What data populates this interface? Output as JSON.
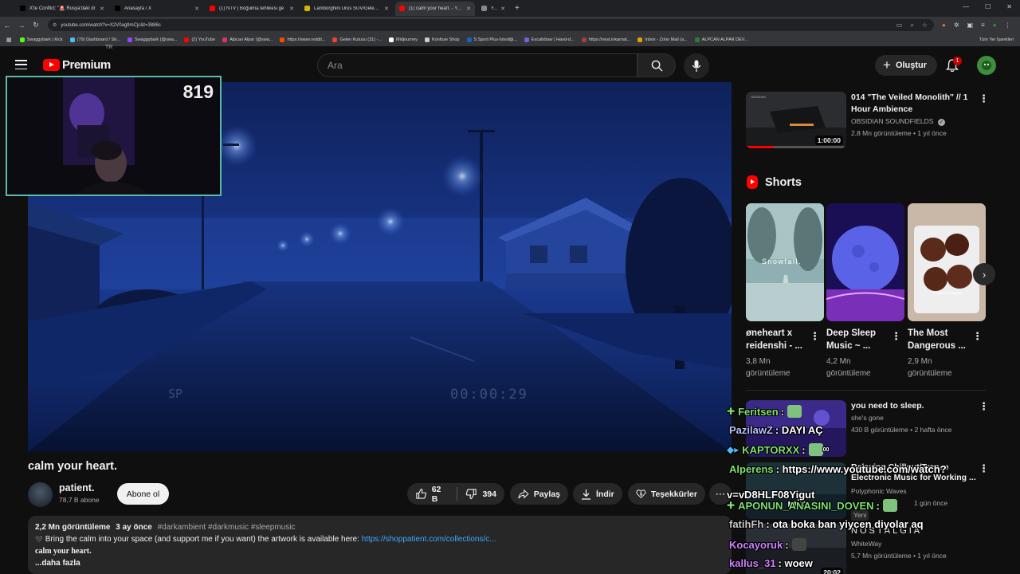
{
  "browser": {
    "tabs": [
      {
        "label": "X'te Conflict: \"🚨 Rusya'daki dr",
        "color": "#000000"
      },
      {
        "label": "Anasayfa / X",
        "color": "#000000"
      },
      {
        "label": "(1) NTV | Boğulma tehlikesi ge",
        "color": "#ff0000"
      },
      {
        "label": "Lamborghini Urus SUV/Gelenek",
        "color": "#d6b400"
      },
      {
        "label": "(1) calm your heart. - YouT",
        "color": "#ff0000",
        "active": true
      },
      {
        "label": "Yükle",
        "color": "#888888"
      }
    ],
    "new_tab": "+",
    "url": "youtube.com/watch?v=X2V0ag9mCjc&t=3886s",
    "bookmarks": [
      {
        "label": "Swaggybark | Kick",
        "color": "#53fc18"
      },
      {
        "label": "(79) Dashboard / Str...",
        "color": "#4fb9f9"
      },
      {
        "label": "Swaggybark (@swa...",
        "color": "#9146ff"
      },
      {
        "label": "(2) YouTube",
        "color": "#ff0000"
      },
      {
        "label": "Alpcan Alpar (@swa...",
        "color": "#e1306c"
      },
      {
        "label": "https://www.reddit...",
        "color": "#ff4500"
      },
      {
        "label": "Gelen Kutusu (31) -...",
        "color": "#ea4335"
      },
      {
        "label": "Midjourney",
        "color": "#ffffff"
      },
      {
        "label": "Konfuse Shop",
        "color": "#cccccc"
      },
      {
        "label": "S Sport Plus-İstediği...",
        "color": "#1565c0"
      },
      {
        "label": "Excalidraw | Hand-d...",
        "color": "#6965db"
      },
      {
        "label": "https://nest.inkarnat...",
        "color": "#a04040"
      },
      {
        "label": "Inbox - Zoho Mail (a...",
        "color": "#e0a000"
      },
      {
        "label": "ALPCAN ALPAR DEV...",
        "color": "#2e7d32"
      }
    ],
    "bookmarks_right": "Tüm Yer İşaretleri"
  },
  "header": {
    "logo_text": "Premium",
    "logo_sup": "TR",
    "search_placeholder": "Ara",
    "create_label": "Oluştur",
    "notif_count": "1"
  },
  "player": {
    "webcam_count": "819",
    "overlay_time": "00:00:29",
    "overlay_sp": "SP"
  },
  "video": {
    "title": "calm your heart.",
    "channel": "patient.",
    "subs": "78,7 B abone",
    "subscribe": "Abone ol",
    "likes": "62 B",
    "dislikes": "394",
    "share": "Paylaş",
    "download": "İndir",
    "thanks": "Teşekkürler",
    "more": "⋯"
  },
  "description": {
    "views": "2,2 Mn görüntüleme",
    "date": "3 ay önce",
    "tags": "#darkambient #darkmusic #sleepmusic",
    "line1": "Bring the calm into your space (and support me if you want) the artwork is available here:",
    "link": "https://shoppatient.com/collections/c...",
    "line2": "calm your heart.",
    "more": "...daha fazla"
  },
  "recommendations": {
    "top": {
      "title_line1": "014 \"The Veiled Monolith\" // 1",
      "title_line2": "Hour Ambience",
      "channel": "OBSIDIAN SOUNDFIELDS",
      "meta": "2,8 Mn görüntüleme • 1 yıl önce",
      "duration": "1:00:00",
      "progress": 0.28
    },
    "shorts_label": "Shorts",
    "shorts": [
      {
        "line1": "øneheart x",
        "line2": "reidenshi - ...",
        "views1": "3,8 Mn",
        "views2": "görüntüleme",
        "overlay": "Snowfall."
      },
      {
        "line1": "Deep Sleep",
        "line2": "Music ~ ...",
        "views1": "4,2 Mn",
        "views2": "görüntüleme",
        "overlay": ""
      },
      {
        "line1": "The Most",
        "line2": "Dangerous ...",
        "views1": "2,9 Mn",
        "views2": "görüntüleme",
        "overlay": "it's just an apple"
      }
    ],
    "list": [
      {
        "title": "you need to sleep.",
        "channel": "she's gone",
        "meta": "430 B görüntüleme • 2 hafta önce"
      },
      {
        "title_line1": "Relaxing Chillout/Trance",
        "title_line2": "Electronic Music for Working ...",
        "channel": "Polyphonic Waves",
        "meta": "1 gün önce",
        "badge": "Yeni"
      },
      {
        "title": "NOSTALGIA",
        "channel": "WhiteWay",
        "meta": "5,7 Mn görüntüleme • 1 yıl önce",
        "duration": "20:02"
      }
    ]
  },
  "chat": [
    {
      "user": "Feritsen",
      "text": ":",
      "color": "#7ee06e",
      "emote": true,
      "badge": "✚"
    },
    {
      "user": "PazilawZ",
      "text": ": DAYI AÇ",
      "color": "#b0b0ff"
    },
    {
      "user": "KAPTORXX",
      "text": ":",
      "color": "#7ee06e",
      "emote": true,
      "badge": "◆▸",
      "trail": "00"
    },
    {
      "user": "Alperens",
      "text": ": https://www.youtube.com/watch?",
      "color": "#7ee06e"
    },
    {
      "user": "",
      "text": "v=vD8HLF08Yigut",
      "color": "#ffffff",
      "extra": "mix"
    },
    {
      "user": "APONUN_ANASINI_DOVEN",
      "text": ":",
      "color": "#7ee06e",
      "emote": true,
      "badge": "✚"
    },
    {
      "user": "fatihFh",
      "text": ": ota boka ban yiycen diyolar aq",
      "color": "#c0c0c0"
    },
    {
      "user": "Kocayoruk",
      "text": ":",
      "color": "#d080ff",
      "emote_dark": true
    },
    {
      "user": "kallus_31",
      "text": ": woew",
      "color": "#d080ff"
    }
  ]
}
